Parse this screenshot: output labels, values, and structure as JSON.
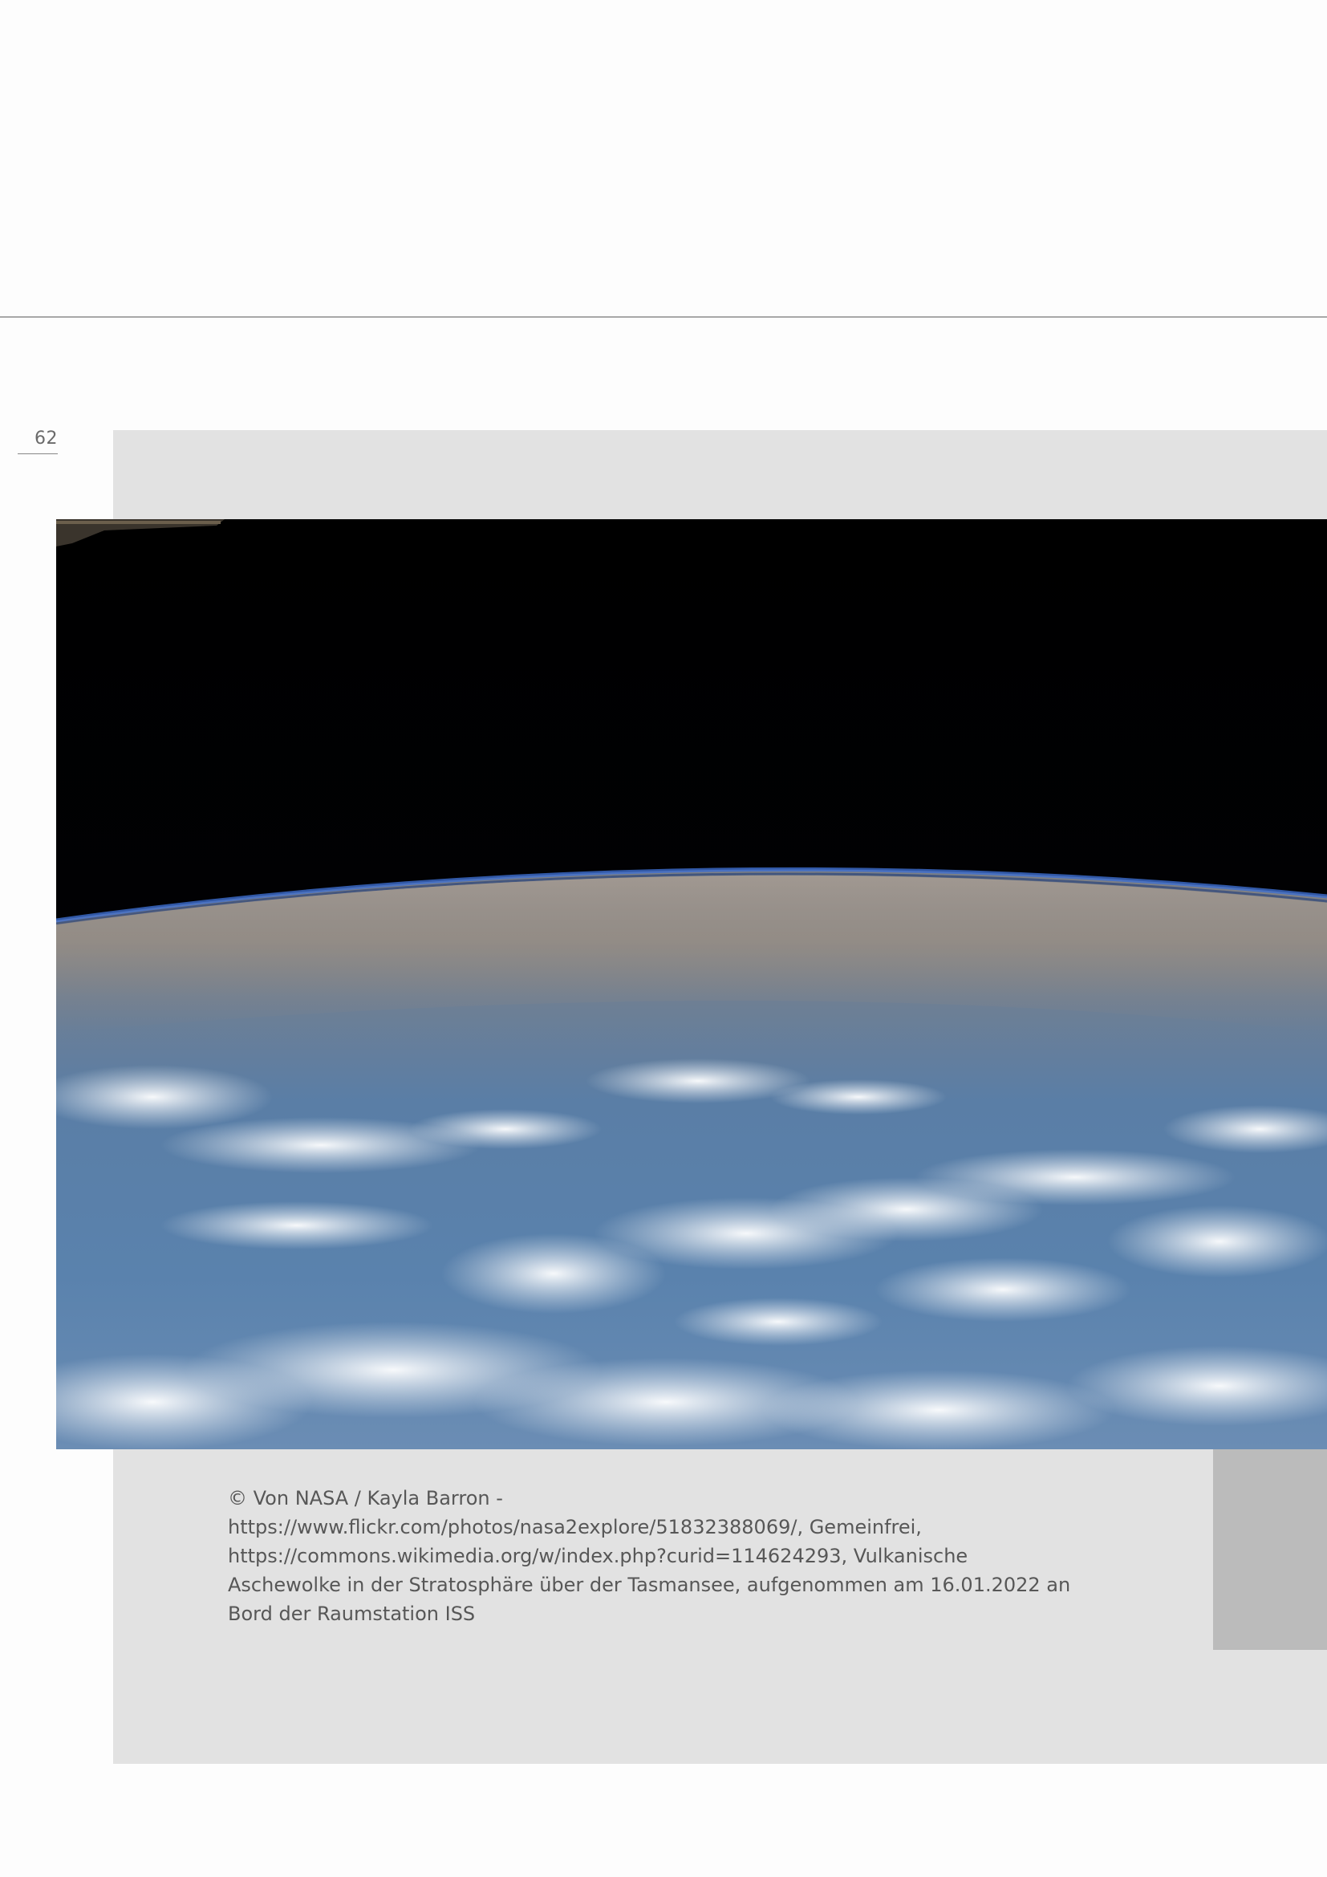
{
  "page": {
    "number": "62"
  },
  "figure": {
    "description_icon": "earth-photo-icon",
    "caption": "© Von NASA / Kayla Barron - https://www.flickr.com/photos/nasa2explore/51832388069/, Gemeinfrei, https://commons.wikimedia.org/w/index.php?curid=114624293, Vulkanische Aschewolke in der Stratosphäre über der Tasmansee, aufgenommen am 16.01.2022 an Bord der Raumstation ISS"
  },
  "colors": {
    "panel": "#e2e2e2",
    "block": "#bbbbbb",
    "rule": "#a8a8a8",
    "text": "#575757"
  }
}
